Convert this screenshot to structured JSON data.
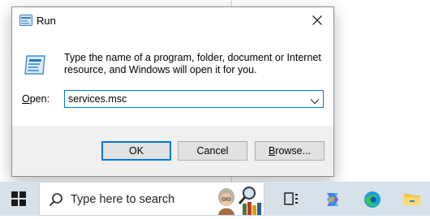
{
  "dialog": {
    "title": "Run",
    "description_line1": "Type the name of a program, folder, document or Internet",
    "description_line2": "resource, and Windows will open it for you.",
    "open_label_prefix": "O",
    "open_label_rest": "pen:",
    "open_value": "services.msc",
    "buttons": {
      "ok": "OK",
      "cancel": "Cancel",
      "browse_prefix": "B",
      "browse_rest": "rowse..."
    }
  },
  "taskbar": {
    "search_placeholder": "Type here to search",
    "icons": [
      "windows-start-icon",
      "search-icon",
      "task-view-icon",
      "copilot-icon",
      "edge-icon",
      "file-explorer-icon"
    ]
  },
  "colors": {
    "accent": "#0078d7",
    "taskbar_bg": "#d7e1ea",
    "dialog_footer": "#f0f0f0"
  }
}
